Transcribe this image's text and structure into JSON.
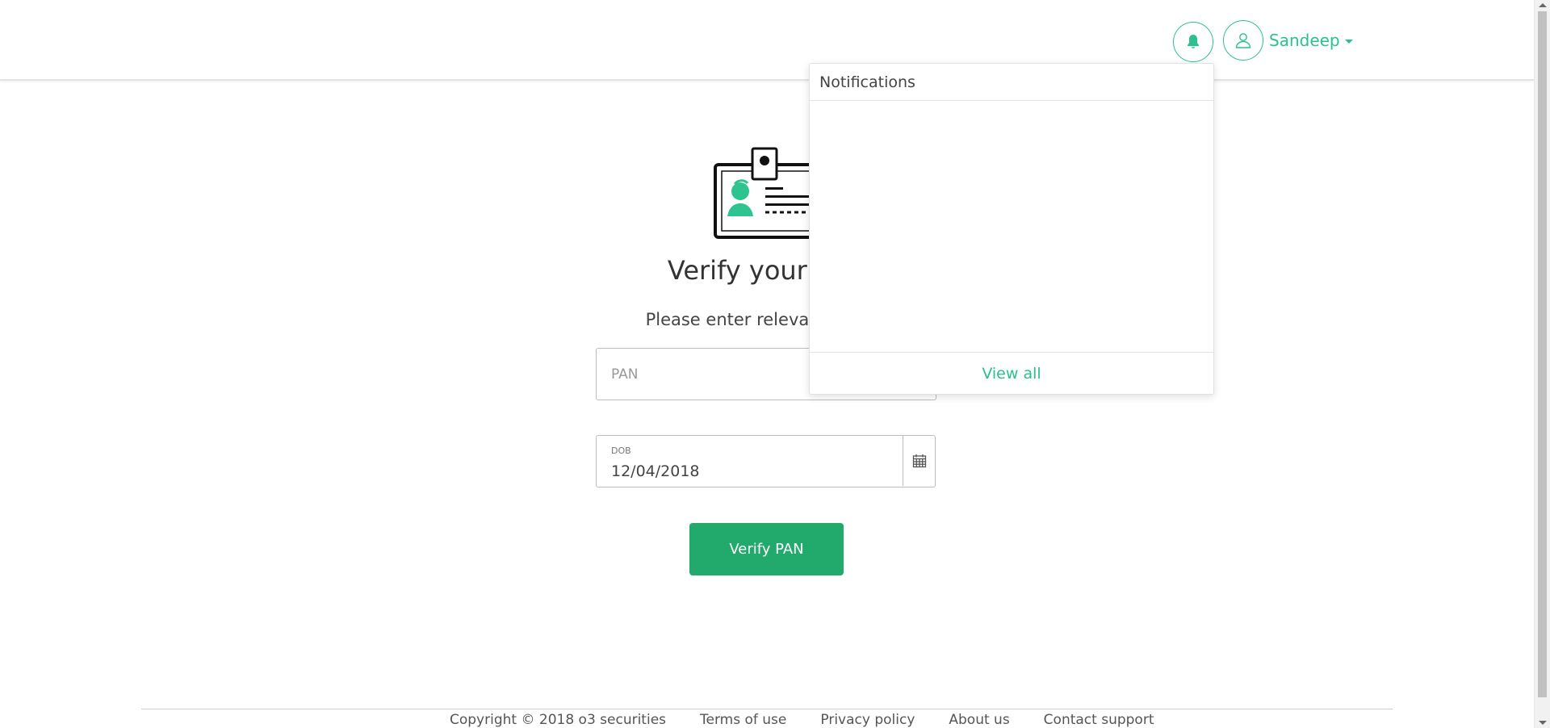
{
  "header": {
    "user_name": "Sandeep",
    "icons": {
      "bell": "bell-icon",
      "avatar": "user-icon",
      "caret": "caret-down-icon"
    }
  },
  "main": {
    "heading": "Verify your PAN",
    "subheading": "Please enter relevant details",
    "pan_placeholder": "PAN",
    "pan_value": "",
    "dob_label": "DOB",
    "dob_value": "12/04/2018",
    "verify_button": "Verify PAN"
  },
  "notifications": {
    "title": "Notifications",
    "view_all": "View all",
    "items": []
  },
  "footer": {
    "copyright": "Copyright © 2018 o3 securities",
    "links": [
      "Terms of use",
      "Privacy policy",
      "About us",
      "Contact support"
    ]
  },
  "colors": {
    "accent": "#2bc08f",
    "button": "#22a96c"
  }
}
